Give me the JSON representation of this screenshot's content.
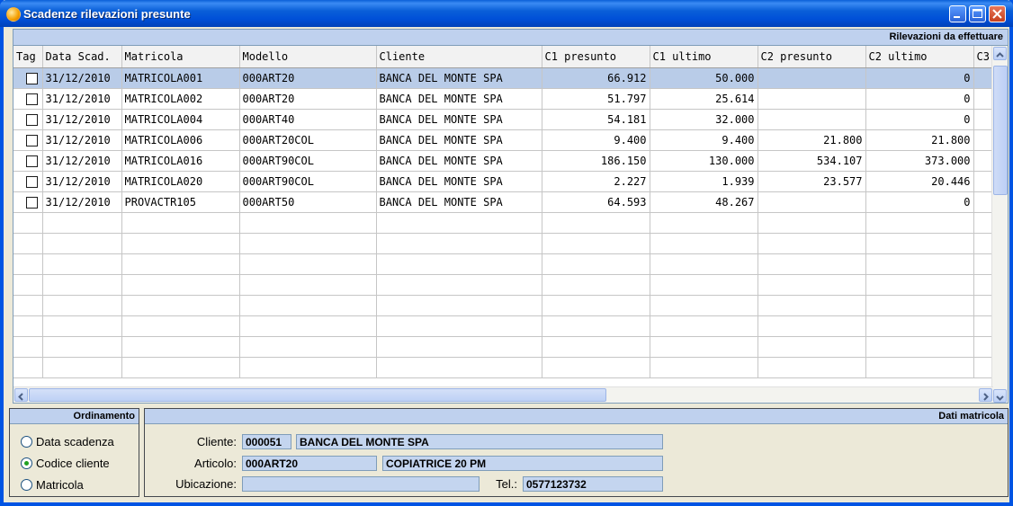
{
  "window": {
    "title": "Scadenze rilevazioni presunte"
  },
  "grid": {
    "header_title": "Rilevazioni da effettuare",
    "columns": [
      "Tag",
      "Data Scad.",
      "Matricola",
      "Modello",
      "Cliente",
      "C1 presunto",
      "C1 ultimo",
      "C2 presunto",
      "C2 ultimo",
      "C3"
    ],
    "rows": [
      [
        "",
        "31/12/2010",
        "MATRICOLA001",
        "000ART20",
        "BANCA DEL MONTE SPA",
        "66.912",
        "50.000",
        "",
        "0"
      ],
      [
        "",
        "31/12/2010",
        "MATRICOLA002",
        "000ART20",
        "BANCA DEL MONTE SPA",
        "51.797",
        "25.614",
        "",
        "0"
      ],
      [
        "",
        "31/12/2010",
        "MATRICOLA004",
        "000ART40",
        "BANCA DEL MONTE SPA",
        "54.181",
        "32.000",
        "",
        "0"
      ],
      [
        "",
        "31/12/2010",
        "MATRICOLA006",
        "000ART20COL",
        "BANCA DEL MONTE SPA",
        "9.400",
        "9.400",
        "21.800",
        "21.800"
      ],
      [
        "",
        "31/12/2010",
        "MATRICOLA016",
        "000ART90COL",
        "BANCA DEL MONTE SPA",
        "186.150",
        "130.000",
        "534.107",
        "373.000"
      ],
      [
        "",
        "31/12/2010",
        "MATRICOLA020",
        "000ART90COL",
        "BANCA DEL MONTE SPA",
        "2.227",
        "1.939",
        "23.577",
        "20.446"
      ],
      [
        "",
        "31/12/2010",
        "PROVACTR105",
        "000ART50",
        "BANCA DEL MONTE SPA",
        "64.593",
        "48.267",
        "",
        "0"
      ]
    ],
    "selected_row": 0
  },
  "ordinamento": {
    "title": "Ordinamento",
    "options": [
      "Data scadenza",
      "Codice cliente",
      "Matricola"
    ],
    "selected": 1
  },
  "dati_matricola": {
    "title": "Dati matricola",
    "cliente_label": "Cliente:",
    "cliente_code": "000051",
    "cliente_name": "BANCA DEL MONTE SPA",
    "articolo_label": "Articolo:",
    "articolo_code": "000ART20",
    "articolo_desc": "COPIATRICE 20 PM",
    "ubicazione_label": "Ubicazione:",
    "ubicazione_value": "",
    "tel_label": "Tel.:",
    "tel_value": "0577123732"
  }
}
